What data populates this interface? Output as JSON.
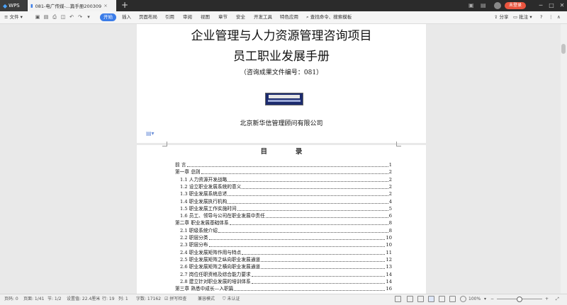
{
  "titlebar": {
    "app_tab": "WPS",
    "doc_tab": "081-电广传媒-...篇手册200309",
    "login": "未登录",
    "win_controls": [
      "minimize-icon",
      "maximize-icon",
      "close-icon"
    ]
  },
  "menubar": {
    "file": "文件",
    "items": [
      "开始",
      "插入",
      "页面布局",
      "引用",
      "审阅",
      "视图",
      "章节",
      "安全",
      "开发工具",
      "特色应用"
    ],
    "active": "开始",
    "search": "查找命令、搜索模板",
    "share": "分享",
    "comment": "批注",
    "help": "?"
  },
  "cover": {
    "title1": "企业管理与人力资源管理咨询项目",
    "title2": "员工职业发展手册",
    "doc_no": "（咨询成果文件编号：081）",
    "company": "北京新华信管理顾问有限公司"
  },
  "toc": {
    "heading": "目            录",
    "rows": [
      {
        "t": "前  言",
        "p": "1",
        "indent": false
      },
      {
        "t": "第一章 总则",
        "p": "2",
        "indent": false
      },
      {
        "t": "1.1 人力资源开发战略",
        "p": "2",
        "indent": true
      },
      {
        "t": "1.2 设立职业发展系统的意义",
        "p": "2",
        "indent": true
      },
      {
        "t": "1.3 职业发展系统总述",
        "p": "2",
        "indent": true
      },
      {
        "t": "1.4 职业发展执行机构",
        "p": "4",
        "indent": true
      },
      {
        "t": "1.5 职业发展工作实施时间",
        "p": "5",
        "indent": true
      },
      {
        "t": "1.6 员工、领导与公司在职业发展中责任",
        "p": "6",
        "indent": true
      },
      {
        "t": "第二章 职业发展基础体系",
        "p": "8",
        "indent": false
      },
      {
        "t": "2.1 职级系统介绍",
        "p": "8",
        "indent": true
      },
      {
        "t": "2.2 职层分类",
        "p": "10",
        "indent": true
      },
      {
        "t": "2.3 职层分布",
        "p": "10",
        "indent": true
      },
      {
        "t": "2.4 职业发展矩阵作用与特点",
        "p": "11",
        "indent": true
      },
      {
        "t": "2.5 职业发展矩阵之纵向职业发展通道",
        "p": "12",
        "indent": true
      },
      {
        "t": "2.6 职业发展矩阵之横向职业发展通道",
        "p": "13",
        "indent": true
      },
      {
        "t": "2.7 岗位任职资格及综合能力要求",
        "p": "14",
        "indent": true
      },
      {
        "t": "2.8 建立针对职业发展的培训体系",
        "p": "14",
        "indent": true
      },
      {
        "t": "第三章 熟悉中成长—入职篇",
        "p": "16",
        "indent": false
      }
    ]
  },
  "status": {
    "page_no": "页码: 0",
    "pages": "页面: 1/41",
    "section": "节: 1/2",
    "setting": "设置值: 22.4厘米",
    "row": "行: 19",
    "col": "列: 1",
    "words": "字数: 17162",
    "spell": "拼写检查",
    "compat": "兼容模式",
    "cert": "未认证",
    "zoom": "100%"
  }
}
